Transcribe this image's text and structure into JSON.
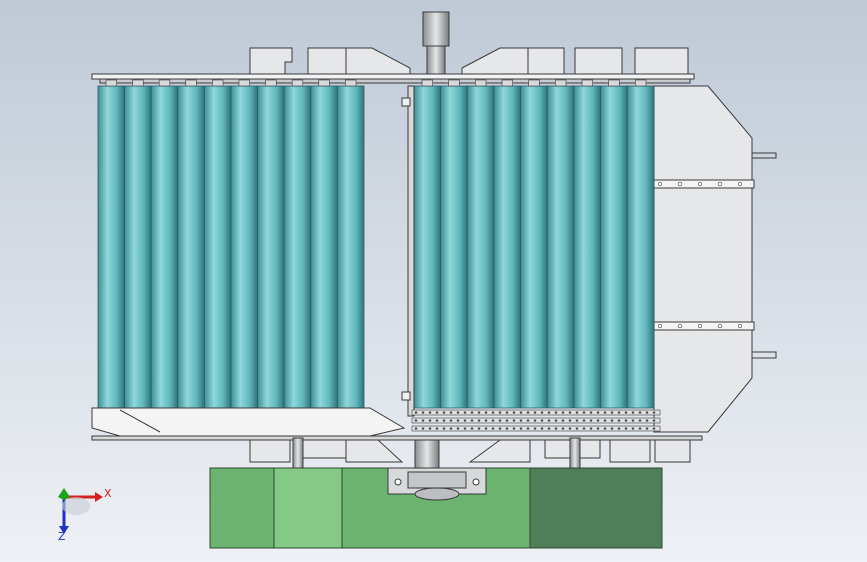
{
  "viewport": {
    "background_top": "#bfc9d6",
    "background_bottom": "#eef1f5"
  },
  "model": {
    "roller_color": "#5fb8bd",
    "roller_dark": "#3d8f95",
    "roller_light": "#8fd7da",
    "frame_color": "#e6e7e9",
    "frame_stroke": "#3a3a3a",
    "base_green": "#6bb36e",
    "base_green_light": "#86c987",
    "base_green_dark": "#4f7f58",
    "left_roller_count": 10,
    "right_roller_count": 9
  },
  "triad": {
    "x_label": "X",
    "z_label": "Z",
    "x_color": "#d62020",
    "y_color": "#1aa31a",
    "z_color": "#2030c8"
  }
}
